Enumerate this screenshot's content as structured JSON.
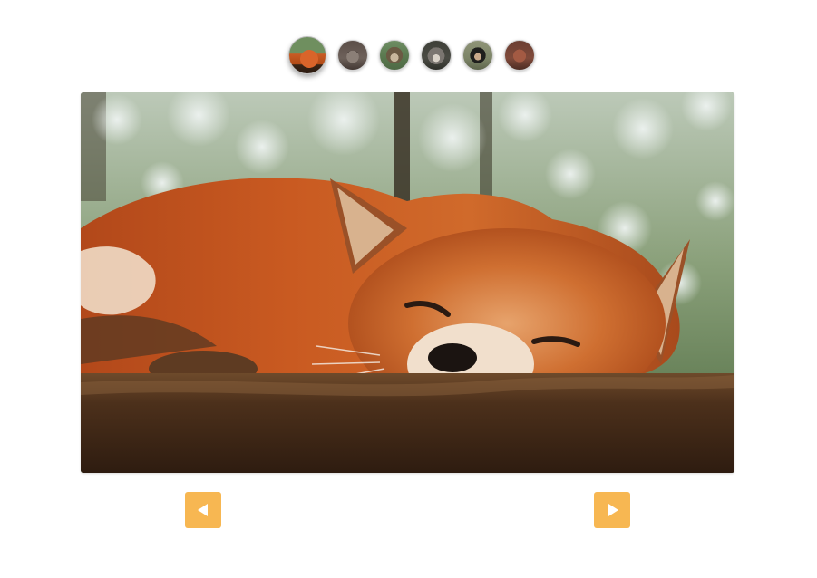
{
  "gallery": {
    "active_index": 0,
    "thumbnails": [
      {
        "subject": "fox",
        "active": true
      },
      {
        "subject": "raccoon",
        "active": false
      },
      {
        "subject": "bear",
        "active": false
      },
      {
        "subject": "wolf",
        "active": false
      },
      {
        "subject": "monkey",
        "active": false
      },
      {
        "subject": "owl",
        "active": false
      }
    ],
    "main_image_subject": "fox"
  },
  "controls": {
    "prev_icon": "triangle-left-icon",
    "next_icon": "triangle-right-icon",
    "accent_color": "#f7b752"
  }
}
